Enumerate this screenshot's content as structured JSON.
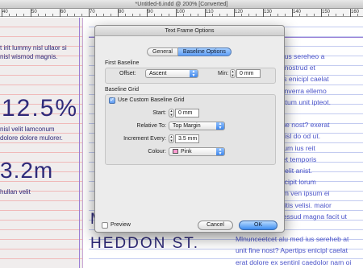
{
  "window": {
    "title": "*Untitled-6.indd @ 200% [Converted]"
  },
  "ruler": {
    "labels": [
      "40",
      "50",
      "60",
      "70",
      "80",
      "90",
      "100",
      "110",
      "120",
      "130",
      "140",
      "150",
      "160"
    ]
  },
  "document": {
    "left_page": {
      "lines_top": [
        "t irit lummy nisl ullaor si",
        "nisl wismod magnis."
      ],
      "big_number_1": "12.5%",
      "lines_mid": [
        "nisl velit lamconum",
        "dolore dolore mulorer."
      ],
      "big_number_2": "3.2m",
      "lines_bottom": [
        "hullan velit"
      ]
    },
    "right_page": {
      "body_lines": [
        "emcat alu med ius sereheo a",
        "ecas, ut ventan nostrud et",
        "upicent. Apertips enicipl caelat",
        "ius et, am dem inverra ellemo",
        "erdonto comeactum unit ipteot.",
        "",
        "unit ipsum int fine nost? exerat",
        "erkiod sotem duisl do od ut.",
        "unturn comeactum ius reit",
        "unit ipsus nam et temporis",
        "utprot inagnim velit anist.",
        "unquimi as fe facipit lorum",
        "commulugam am ven ipsum ei",
        "am nisimeroi reiitis velisi. maior",
        "ectiv. nost concessud magna facit ut",
        "",
        "Mlnunceetcet alu med ius sereheb at",
        "unit fine nost? Apertips enicipl caelat",
        "erat dolore ex sentinl caedolor nam oi"
      ],
      "partial_heading": "M",
      "heading": "HEDDON ST."
    }
  },
  "dialog": {
    "title": "Text Frame Options",
    "tabs": [
      {
        "label": "General",
        "active": false
      },
      {
        "label": "Baseline Options",
        "active": true
      }
    ],
    "first_baseline": {
      "group_label": "First Baseline",
      "offset_label": "Offset:",
      "offset_value": "Ascent",
      "min_label": "Min:",
      "min_value": "0 mm"
    },
    "baseline_grid": {
      "group_label": "Baseline Grid",
      "use_custom_label": "Use Custom Baseline Grid",
      "use_custom_checked": true,
      "start_label": "Start:",
      "start_value": "0 mm",
      "relative_label": "Relative To:",
      "relative_value": "Top Margin",
      "increment_label": "Increment Every:",
      "increment_value": "3.5 mm",
      "colour_label": "Colour:",
      "colour_value": "Pink",
      "colour_swatch": "#ff9bd0"
    },
    "preview_label": "Preview",
    "preview_checked": false,
    "cancel_label": "Cancel",
    "ok_label": "OK"
  },
  "colors": {
    "accent": "#3d8cf0",
    "text_blue": "#2f2a7a",
    "body_blue": "#4b54c9",
    "baseline_pink": "#f0b9b9",
    "baseline_blue": "#c3cbf0"
  },
  "icons": {
    "popup_arrows": "updown-arrows-icon",
    "stepper": "stepper-icon",
    "checkmark": "checkmark-icon"
  }
}
